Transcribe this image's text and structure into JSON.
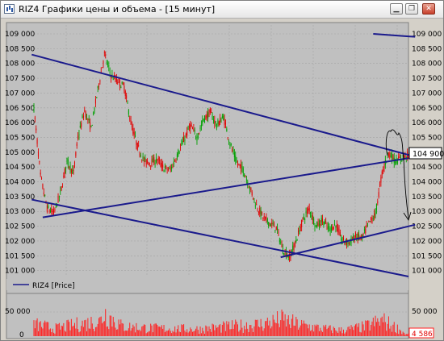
{
  "window": {
    "title": "RIZ4 Графики цены и объема - [15 минут]",
    "icons": {
      "app": "chart-icon",
      "minimize": "minimize-icon",
      "restore": "restore-icon",
      "close": "close-icon"
    },
    "button_glyphs": {
      "minimize": "▁",
      "restore": "❐",
      "close": "✕"
    }
  },
  "price_panel": {
    "y_ticks": [
      "109 000",
      "108 500",
      "108 000",
      "107 500",
      "107 000",
      "106 500",
      "106 000",
      "105 500",
      "105 000",
      "104 500",
      "104 000",
      "103 500",
      "103 000",
      "102 500",
      "102 000",
      "101 500",
      "101 000"
    ],
    "current_price": "104 900",
    "legend": "RIZ4 [Price]"
  },
  "volume_panel": {
    "y_ticks": [
      "50 000",
      "0"
    ],
    "current_volume": "4 586"
  },
  "colors": {
    "background": "#c0c0c0",
    "grid": "#a4a4a4",
    "up_candle": "#00a000",
    "down_candle": "#e00000",
    "trendline": "#1a1a8c",
    "volume": "#ff2020",
    "drawing": "#000000"
  },
  "chart_data": {
    "type": "candlestick",
    "instrument": "RIZ4",
    "timeframe": "15 минут",
    "ylim": [
      100800,
      109300
    ],
    "price_path": [
      [
        0,
        106500
      ],
      [
        6,
        104200
      ],
      [
        12,
        103100
      ],
      [
        18,
        102950
      ],
      [
        24,
        103600
      ],
      [
        30,
        104700
      ],
      [
        36,
        104300
      ],
      [
        40,
        105500
      ],
      [
        46,
        106400
      ],
      [
        52,
        105800
      ],
      [
        58,
        107100
      ],
      [
        64,
        108300
      ],
      [
        70,
        107600
      ],
      [
        76,
        107400
      ],
      [
        82,
        107200
      ],
      [
        88,
        106000
      ],
      [
        94,
        105200
      ],
      [
        100,
        104700
      ],
      [
        106,
        104650
      ],
      [
        112,
        104750
      ],
      [
        118,
        104450
      ],
      [
        124,
        104400
      ],
      [
        130,
        104900
      ],
      [
        136,
        105400
      ],
      [
        142,
        105900
      ],
      [
        148,
        105500
      ],
      [
        154,
        106100
      ],
      [
        160,
        106350
      ],
      [
        166,
        105900
      ],
      [
        172,
        106200
      ],
      [
        178,
        105300
      ],
      [
        184,
        104650
      ],
      [
        190,
        104400
      ],
      [
        196,
        103800
      ],
      [
        202,
        103200
      ],
      [
        208,
        102800
      ],
      [
        214,
        102600
      ],
      [
        220,
        102450
      ],
      [
        226,
        101700
      ],
      [
        232,
        101450
      ],
      [
        238,
        102000
      ],
      [
        244,
        102700
      ],
      [
        250,
        103100
      ],
      [
        256,
        102500
      ],
      [
        262,
        102700
      ],
      [
        268,
        102400
      ],
      [
        274,
        102550
      ],
      [
        280,
        102000
      ],
      [
        286,
        101950
      ],
      [
        292,
        102150
      ],
      [
        298,
        102100
      ],
      [
        304,
        102600
      ],
      [
        310,
        102900
      ],
      [
        316,
        104300
      ],
      [
        322,
        105000
      ],
      [
        328,
        104700
      ],
      [
        334,
        104800
      ],
      [
        338,
        104900
      ]
    ],
    "trendlines_price": [
      {
        "from": [
          -2,
          108300
        ],
        "to": [
          346,
          104850
        ]
      },
      {
        "from": [
          8,
          102800
        ],
        "to": [
          340,
          104800
        ]
      },
      {
        "from": [
          -2,
          103400
        ],
        "to": [
          340,
          100800
        ]
      },
      {
        "from": [
          224,
          101450
        ],
        "to": [
          346,
          102550
        ]
      },
      {
        "from": [
          308,
          109000
        ],
        "to": [
          346,
          108900
        ]
      }
    ],
    "volume_profile": [
      [
        0,
        30000
      ],
      [
        20,
        20000
      ],
      [
        40,
        30000
      ],
      [
        60,
        38000
      ],
      [
        64,
        60000
      ],
      [
        80,
        25000
      ],
      [
        110,
        20000
      ],
      [
        150,
        18000
      ],
      [
        180,
        25000
      ],
      [
        205,
        30000
      ],
      [
        225,
        42000
      ],
      [
        240,
        30000
      ],
      [
        260,
        20000
      ],
      [
        280,
        15000
      ],
      [
        300,
        24000
      ],
      [
        316,
        40000
      ],
      [
        330,
        20000
      ],
      [
        338,
        4586
      ]
    ],
    "volume_ylim": [
      0,
      75000
    ]
  }
}
